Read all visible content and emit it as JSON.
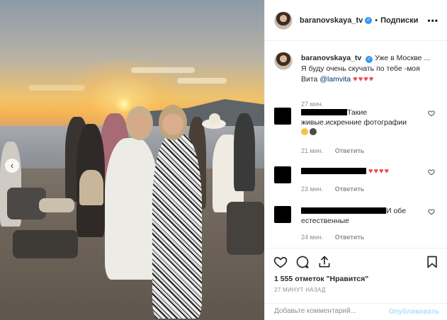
{
  "post": {
    "author": "baranovskaya_tv",
    "separator": "•",
    "follow_label": "Подписки",
    "more_label": "•••",
    "prev_label": "‹"
  },
  "caption": {
    "author": "baranovskaya_tv",
    "text_line1": "Уже в Москве ...",
    "text_line2": "Я буду очень скучать по тебе -моя",
    "text_line3_prefix": "Вита ",
    "mention": "@lamvita",
    "hearts": "♥♥♥♥",
    "time": "27 мин."
  },
  "comments": [
    {
      "text": "Такие",
      "text2": "живые.искренние фотографии",
      "time": "21 мин.",
      "reply": "Ответить",
      "emoji": [
        "heart-eyes-emoji",
        "sunglasses-emoji"
      ]
    },
    {
      "hearts": "♥♥♥♥",
      "time": "23 мин.",
      "reply": "Ответить"
    },
    {
      "text": "И обе",
      "text2": "естественные",
      "time": "24 мин.",
      "reply": "Ответить"
    }
  ],
  "likes": "1 555 отметок \"Нравится\"",
  "posted_ago": "27 МИНУТ НАЗАД",
  "add_comment": {
    "placeholder": "Добавьте комментарий...",
    "publish_label": "Опубликовать"
  },
  "icons": [
    "heart-icon",
    "comment-icon",
    "share-icon",
    "bookmark-icon",
    "verified-icon"
  ],
  "colors": {
    "accent": "#3897f0",
    "heart": "#ed4956",
    "muted": "#8e8e8e",
    "publish_disabled": "#b2dffc"
  }
}
